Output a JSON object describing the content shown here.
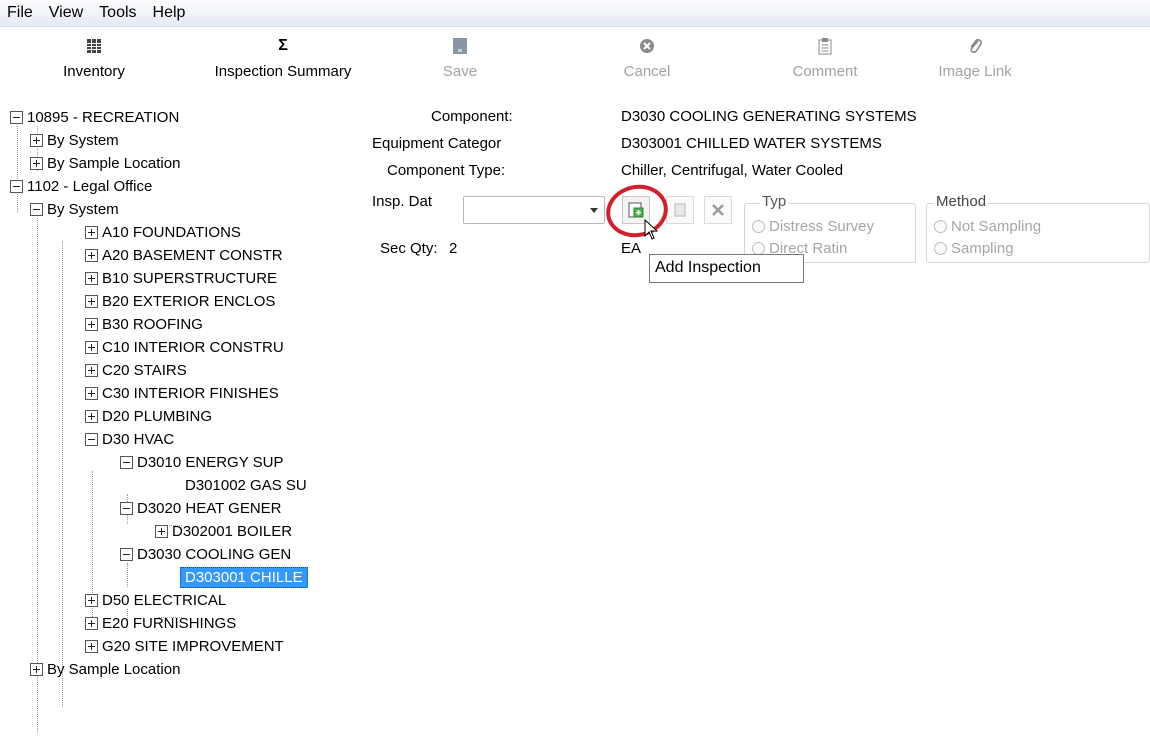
{
  "menu": [
    "File",
    "View",
    "Tools",
    "Help"
  ],
  "toolbar": {
    "inventory": "Inventory",
    "inspection_summary": "Inspection Summary",
    "save": "Save",
    "cancel": "Cancel",
    "comment": "Comment",
    "image_link": "Image Link",
    "sigma": "Σ"
  },
  "tree": {
    "n0": "10895 - RECREATION",
    "n1": "By System",
    "n2": "By Sample Location",
    "n3": "1102 - Legal Office",
    "n4": "By System",
    "n5": "A10 FOUNDATIONS",
    "n6": "A20 BASEMENT CONSTR",
    "n7": "B10 SUPERSTRUCTURE",
    "n8": "B20 EXTERIOR ENCLOS",
    "n9": "B30 ROOFING",
    "n10": "C10 INTERIOR CONSTRU",
    "n11": "C20 STAIRS",
    "n12": "C30 INTERIOR FINISHES",
    "n13": "D20 PLUMBING",
    "n14": "D30 HVAC",
    "n15": "D3010 ENERGY SUP",
    "n16": "D301002 GAS SU",
    "n17": "D3020 HEAT GENER",
    "n18": "D302001 BOILER",
    "n19": "D3030 COOLING GEN",
    "n20": "D303001 CHILLE",
    "n21": "D50 ELECTRICAL",
    "n22": "E20 FURNISHINGS",
    "n23": "G20 SITE IMPROVEMENT",
    "n24": "By Sample Location"
  },
  "details": {
    "component_label": "Component:",
    "component_value": "D3030 COOLING GENERATING SYSTEMS",
    "equipment_label": "Equipment Categor",
    "equipment_value": "D303001 CHILLED WATER SYSTEMS",
    "type_label": "Component Type:",
    "type_value": "Chiller, Centrifugal, Water Cooled",
    "insp_label": "Insp. Dat",
    "secqty_label": "Sec Qty:",
    "secqty_value": "2",
    "partial_text": "EA",
    "typ_group": "Typ",
    "typ_opt1": "Distress Survey",
    "typ_opt2": "Direct Ratin",
    "method_group": "Method",
    "method_opt1": "Not Sampling",
    "method_opt2": "Sampling"
  },
  "tooltip": "Add Inspection",
  "accent": "#3399ff",
  "highlight_color": "#d0202b"
}
